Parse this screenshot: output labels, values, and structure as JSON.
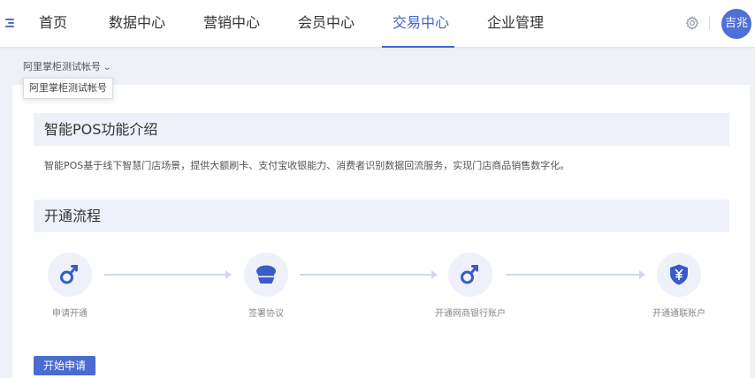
{
  "nav": {
    "items": [
      {
        "label": "首页",
        "active": false
      },
      {
        "label": "数据中心",
        "active": false
      },
      {
        "label": "营销中心",
        "active": false
      },
      {
        "label": "会员中心",
        "active": false
      },
      {
        "label": "交易中心",
        "active": true
      },
      {
        "label": "企业管理",
        "active": false
      }
    ],
    "avatar_text": "吉兆",
    "accent_color": "#3f63d3"
  },
  "account": {
    "selected": "阿里掌柜测试帐号",
    "tooltip": "阿里掌柜测试帐号"
  },
  "intro": {
    "title": "智能POS功能介绍",
    "text": "智能POS基于线下智慧门店场景，提供大额刷卡、支付宝收银能力、消费者识别数据回流服务，实现门店商品销售数字化。"
  },
  "process": {
    "title": "开通流程",
    "steps": [
      {
        "label": "申请开通",
        "icon": "key-icon"
      },
      {
        "label": "签署协议",
        "icon": "seal-icon"
      },
      {
        "label": "开通网商银行账户",
        "icon": "key-icon"
      },
      {
        "label": "开通通联账户",
        "icon": "yen-shield-icon"
      }
    ]
  },
  "actions": {
    "apply_label": "开始申请"
  }
}
